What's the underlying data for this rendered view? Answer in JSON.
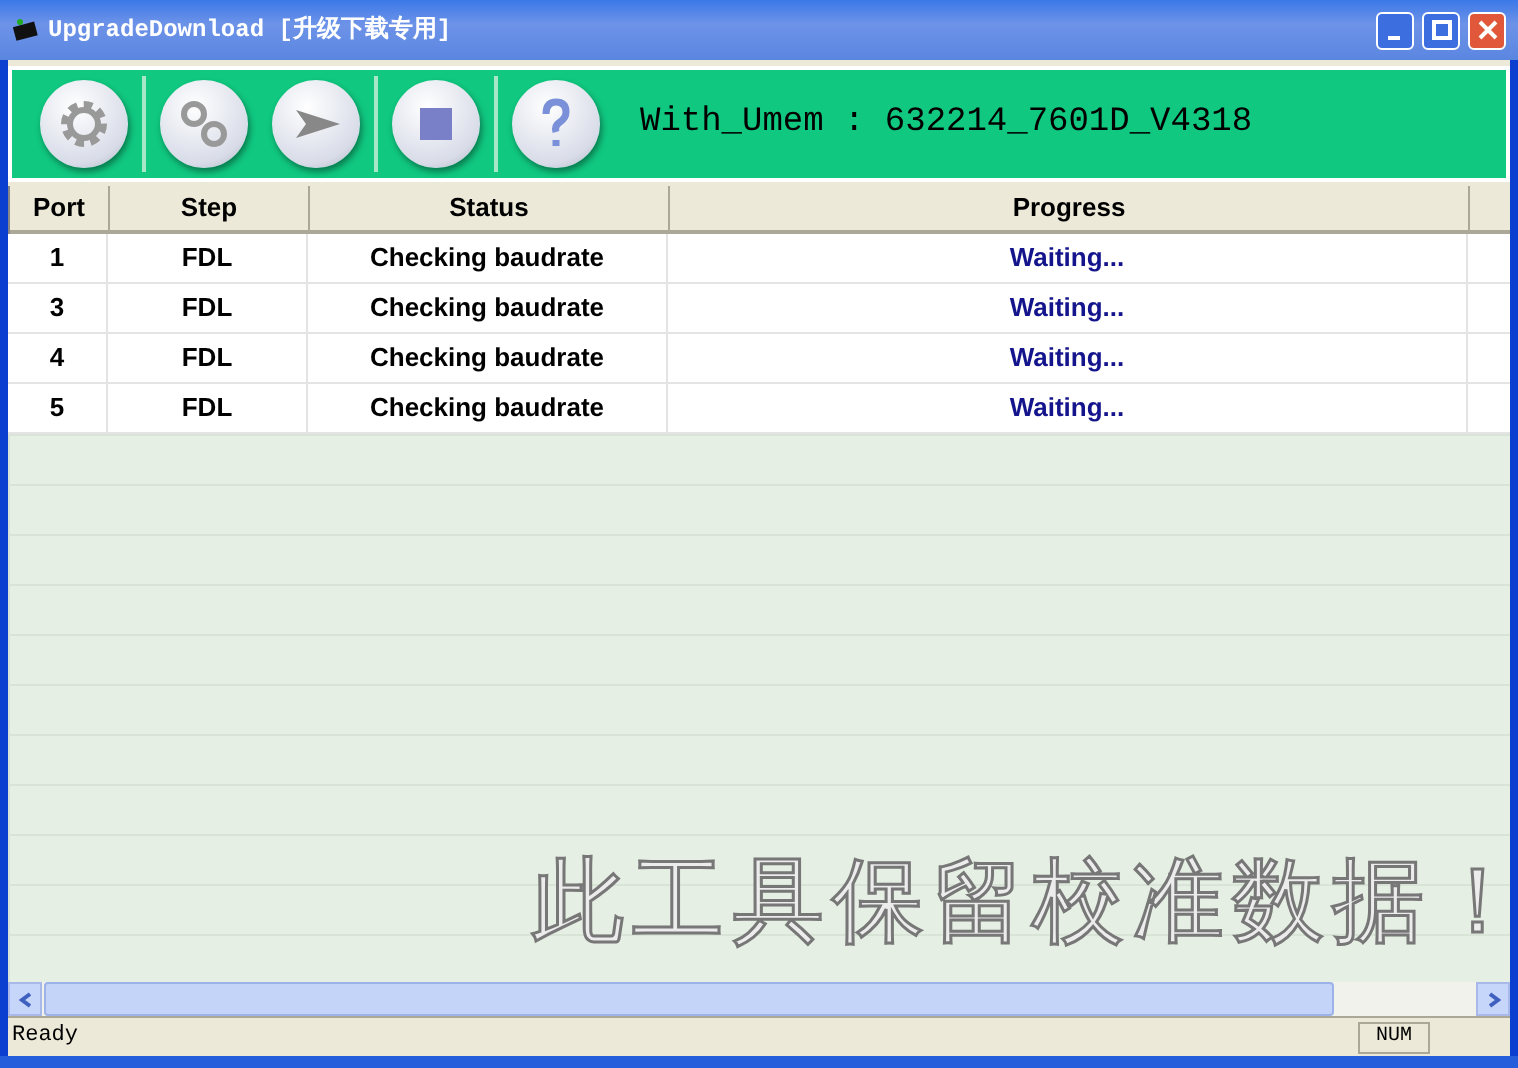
{
  "window": {
    "title": "UpgradeDownload [升级下载专用]"
  },
  "toolbar": {
    "buttons": [
      {
        "kind": "gear"
      },
      {
        "kind": "gears"
      },
      {
        "kind": "play"
      },
      {
        "kind": "stop"
      },
      {
        "kind": "help"
      }
    ],
    "info": "With_Umem : 632214_7601D_V4318"
  },
  "table": {
    "columns": [
      "Port",
      "Step",
      "Status",
      "Progress"
    ],
    "rows": [
      {
        "port": "1",
        "step": "FDL",
        "status": "Checking baudrate",
        "progress": "Waiting..."
      },
      {
        "port": "3",
        "step": "FDL",
        "status": "Checking baudrate",
        "progress": "Waiting..."
      },
      {
        "port": "4",
        "step": "FDL",
        "status": "Checking baudrate",
        "progress": "Waiting..."
      },
      {
        "port": "5",
        "step": "FDL",
        "status": "Checking baudrate",
        "progress": "Waiting..."
      }
    ]
  },
  "annotation": "此工具保留校准数据！",
  "status_bar": {
    "text": "Ready",
    "indicator": "NUM"
  }
}
